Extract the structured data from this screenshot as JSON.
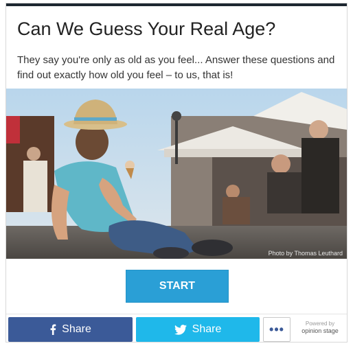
{
  "quiz": {
    "title": "Can We Guess Your Real Age?",
    "description": "They say you're only as old as you feel... Answer these questions and find out exactly how old you feel – to us, that is!",
    "photo_credit": "Photo by Thomas Leuthard",
    "start_label": "START"
  },
  "share": {
    "facebook_label": "Share",
    "twitter_label": "Share",
    "more_label": "•••",
    "powered_line1": "Powered by",
    "powered_line2": "opinion stage"
  },
  "icons": {
    "facebook": "facebook-icon",
    "twitter": "twitter-icon",
    "more": "more-dots-icon"
  },
  "colors": {
    "accent": "#2a9fd6",
    "facebook": "#3b5a98",
    "twitter": "#1fb8ea",
    "topbar": "#1d2731"
  }
}
